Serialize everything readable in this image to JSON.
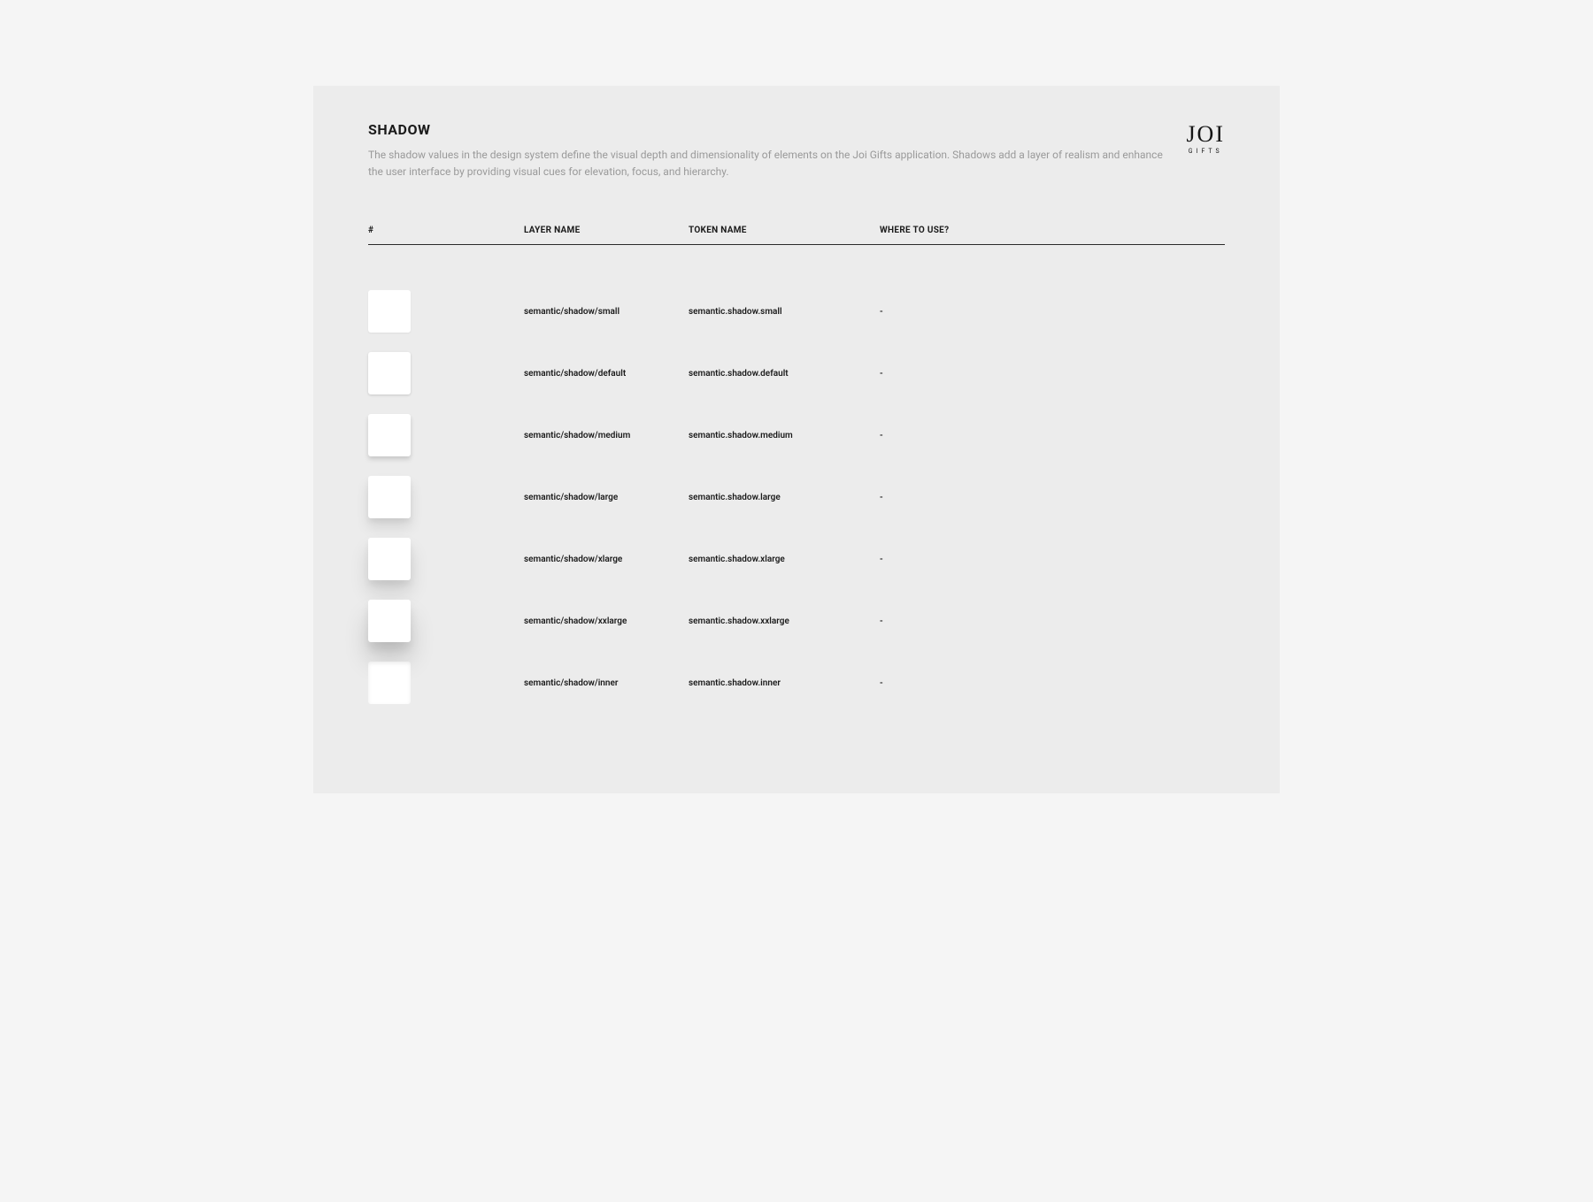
{
  "page": {
    "title": "SHADOW",
    "description": "The shadow values in the design system define the visual depth and dimensionality of elements on the Joi Gifts application. Shadows add a layer of realism and enhance the user interface by providing visual cues for elevation, focus, and hierarchy."
  },
  "brand": {
    "name": "JOI",
    "tagline": "GIFTS"
  },
  "table": {
    "headers": {
      "sample": "#",
      "layer": "LAYER NAME",
      "token": "TOKEN NAME",
      "usage": "WHERE TO USE?"
    },
    "rows": [
      {
        "shadow_key": "small",
        "layer": "semantic/shadow/small",
        "token": "semantic.shadow.small",
        "usage": "-"
      },
      {
        "shadow_key": "default",
        "layer": "semantic/shadow/default",
        "token": "semantic.shadow.default",
        "usage": "-"
      },
      {
        "shadow_key": "medium",
        "layer": "semantic/shadow/medium",
        "token": "semantic.shadow.medium",
        "usage": "-"
      },
      {
        "shadow_key": "large",
        "layer": "semantic/shadow/large",
        "token": "semantic.shadow.large",
        "usage": "-"
      },
      {
        "shadow_key": "xlarge",
        "layer": "semantic/shadow/xlarge",
        "token": "semantic.shadow.xlarge",
        "usage": "-"
      },
      {
        "shadow_key": "xxlarge",
        "layer": "semantic/shadow/xxlarge",
        "token": "semantic.shadow.xxlarge",
        "usage": "-"
      },
      {
        "shadow_key": "inner",
        "layer": "semantic/shadow/inner",
        "token": "semantic.shadow.inner",
        "usage": "-"
      }
    ]
  }
}
